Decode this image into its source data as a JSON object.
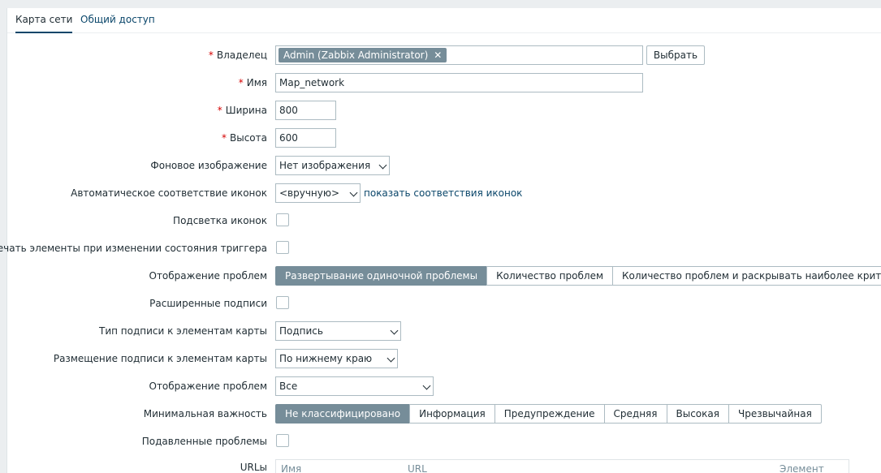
{
  "tabs": [
    {
      "label": "Карта сети",
      "active": true
    },
    {
      "label": "Общий доступ",
      "active": false
    }
  ],
  "form": {
    "owner": {
      "label": "Владелец",
      "required": true,
      "chip": "Admin (Zabbix Administrator)",
      "select_button": "Выбрать"
    },
    "name": {
      "label": "Имя",
      "required": true,
      "value": "Map_network"
    },
    "width": {
      "label": "Ширина",
      "required": true,
      "value": "800"
    },
    "height": {
      "label": "Высота",
      "required": true,
      "value": "600"
    },
    "background": {
      "label": "Фоновое изображение",
      "value": "Нет изображения"
    },
    "icon_mapping": {
      "label": "Автоматическое соответствие иконок",
      "value": "<вручную>",
      "link": "показать соответствия иконок"
    },
    "icon_highlight": {
      "label": "Подсветка иконок",
      "checked": false
    },
    "mark_elements": {
      "label": "Помечать элементы при изменении состояния триггера",
      "checked": false
    },
    "problem_display": {
      "label": "Отображение проблем",
      "options": [
        "Развертывание одиночной проблемы",
        "Количество проблем",
        "Количество проблем и раскрывать наиболее критичную"
      ],
      "selected": 0
    },
    "advanced_labels": {
      "label": "Расширенные подписи",
      "checked": false
    },
    "label_type": {
      "label": "Тип подписи к элементам карты",
      "value": "Подпись"
    },
    "label_location": {
      "label": "Размещение подписи к элементам карты",
      "value": "По нижнему краю"
    },
    "show_problems": {
      "label": "Отображение проблем",
      "value": "Все"
    },
    "min_severity": {
      "label": "Минимальная важность",
      "options": [
        "Не классифицировано",
        "Информация",
        "Предупреждение",
        "Средняя",
        "Высокая",
        "Чрезвычайная"
      ],
      "selected": 0
    },
    "suppressed": {
      "label": "Подавленные проблемы",
      "checked": false
    },
    "urls": {
      "label": "URLы",
      "columns": [
        "Имя",
        "URL",
        "Элемент"
      ]
    }
  }
}
